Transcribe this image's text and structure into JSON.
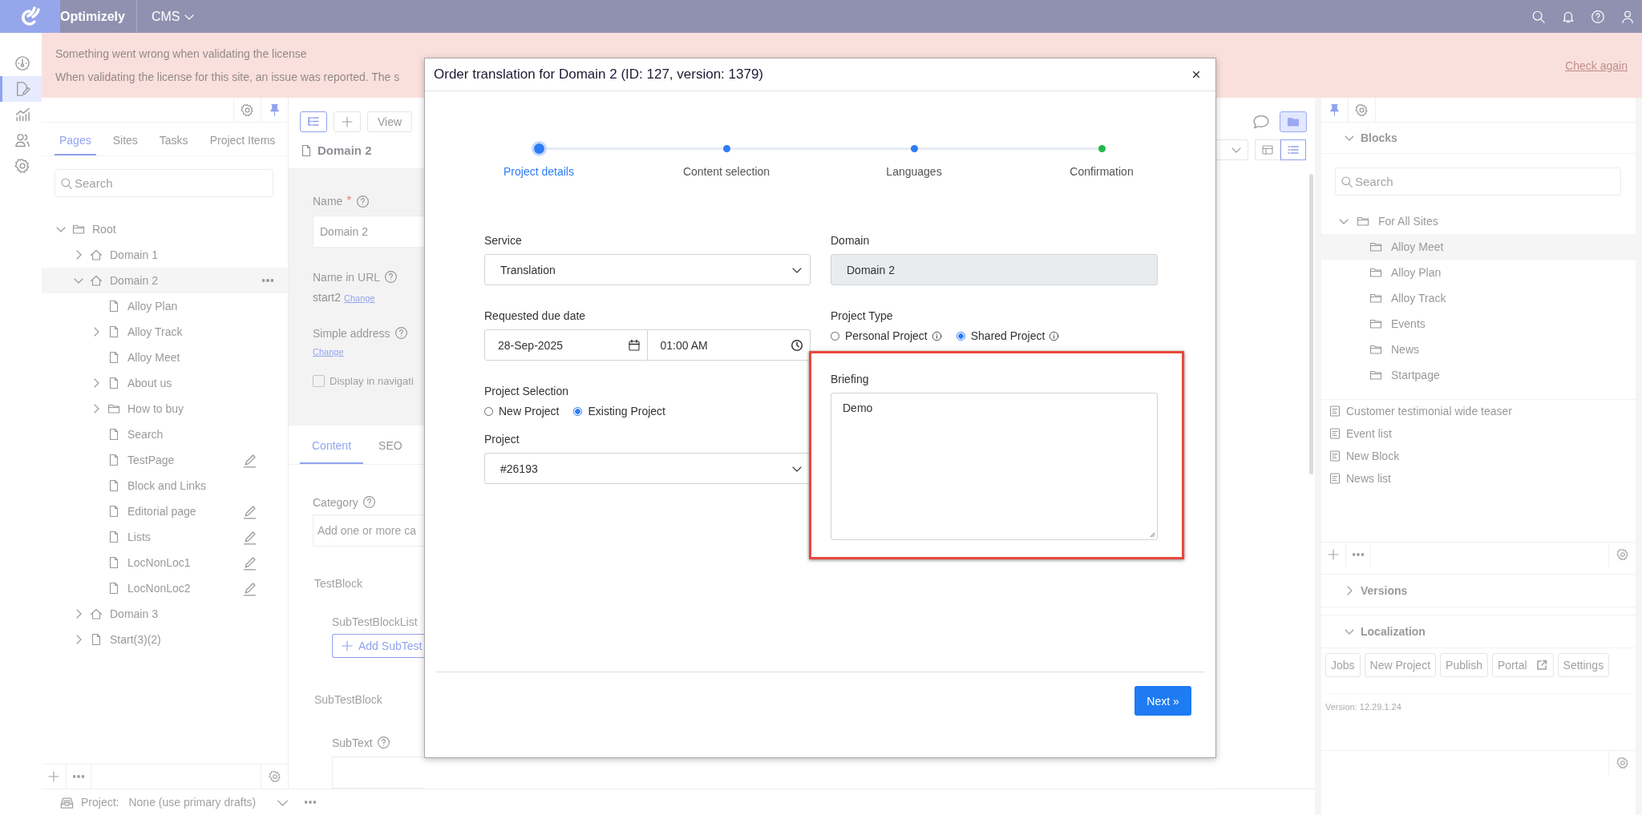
{
  "top_bar": {
    "brand": "Optimizely",
    "product": "CMS"
  },
  "nav_rail": [
    {
      "kind": "dashboard",
      "selected": false
    },
    {
      "kind": "edit",
      "selected": true
    },
    {
      "kind": "reports",
      "selected": false
    },
    {
      "kind": "users",
      "selected": false
    },
    {
      "kind": "settings",
      "selected": false
    }
  ],
  "license_banner": {
    "title": "Something went wrong when validating the license",
    "message": "When validating the license for this site, an issue was reported. The s",
    "action": "Check again"
  },
  "page_tree": {
    "tabs": [
      {
        "label": "Pages",
        "selected": true
      },
      {
        "label": "Sites",
        "selected": false
      },
      {
        "label": "Tasks",
        "selected": false
      },
      {
        "label": "Project Items",
        "selected": false
      }
    ],
    "search": {
      "placeholder": "Search"
    },
    "items": [
      {
        "label": "Root",
        "kind": "folder",
        "expanded": true,
        "selected": false,
        "edited": false,
        "children": [
          {
            "label": "Domain 1",
            "kind": "site",
            "expanded": false,
            "selected": false,
            "edited": false
          },
          {
            "label": "Domain 2",
            "kind": "site",
            "expanded": true,
            "selected": true,
            "edited": false,
            "children": [
              {
                "label": "Alloy Plan",
                "kind": "page",
                "selected": false,
                "edited": false
              },
              {
                "label": "Alloy Track",
                "kind": "page",
                "expanded": false,
                "selected": false,
                "edited": false
              },
              {
                "label": "Alloy Meet",
                "kind": "page",
                "selected": false,
                "edited": false
              },
              {
                "label": "About us",
                "kind": "page",
                "expanded": false,
                "selected": false,
                "edited": false
              },
              {
                "label": "How to buy",
                "kind": "folder",
                "expanded": false,
                "selected": false,
                "edited": false
              },
              {
                "label": "Search",
                "kind": "page",
                "selected": false,
                "edited": false
              },
              {
                "label": "TestPage",
                "kind": "page",
                "selected": false,
                "edited": true
              },
              {
                "label": "Block and Links",
                "kind": "page",
                "selected": false,
                "edited": false
              },
              {
                "label": "Editorial page",
                "kind": "page",
                "selected": false,
                "edited": true
              },
              {
                "label": "Lists",
                "kind": "page",
                "selected": false,
                "edited": true
              },
              {
                "label": "LocNonLoc1",
                "kind": "page",
                "selected": false,
                "edited": true
              },
              {
                "label": "LocNonLoc2",
                "kind": "page",
                "selected": false,
                "edited": true
              }
            ]
          },
          {
            "label": "Domain 3",
            "kind": "site",
            "expanded": false,
            "selected": false,
            "edited": false
          },
          {
            "label": "Start(3)(2)",
            "kind": "page",
            "expanded": false,
            "selected": false,
            "edited": false
          }
        ]
      }
    ]
  },
  "project_bar": {
    "label": "Project:",
    "value": "None (use primary drafts)"
  },
  "editor": {
    "view_button": "View",
    "title": "Domain 2",
    "name": {
      "label": "Name",
      "required": "*",
      "value": "Domain 2"
    },
    "name_in_url": {
      "label": "Name in URL",
      "value": "start2",
      "action": "Change"
    },
    "simple_address": {
      "label": "Simple address",
      "action": "Change"
    },
    "display_in_navigation": {
      "label": "Display in navigati",
      "checked": false
    },
    "tabs": [
      {
        "label": "Content",
        "selected": true
      },
      {
        "label": "SEO",
        "selected": false
      }
    ],
    "category": {
      "label": "Category",
      "placeholder": "Add one or more ca"
    },
    "test_block": {
      "title": "TestBlock",
      "list_label": "SubTestBlockList",
      "add_button": "Add SubTest"
    },
    "sub_test_block": {
      "title": "SubTestBlock",
      "sub_text_label": "SubText"
    }
  },
  "assets_panel": {
    "blocks": {
      "title": "Blocks",
      "expanded": true,
      "search": {
        "placeholder": "Search"
      },
      "folders": [
        {
          "label": "For All Sites",
          "expanded": true,
          "children": [
            {
              "label": "Alloy Meet",
              "selected": true
            },
            {
              "label": "Alloy Plan",
              "selected": false
            },
            {
              "label": "Alloy Track",
              "selected": false
            },
            {
              "label": "Events",
              "selected": false
            },
            {
              "label": "News",
              "selected": false
            },
            {
              "label": "Startpage",
              "selected": false
            }
          ]
        }
      ],
      "items": [
        "Customer testimonial wide teaser",
        "Event list",
        "New Block",
        "News list"
      ]
    },
    "versions": {
      "title": "Versions",
      "expanded": false
    },
    "localization": {
      "title": "Localization",
      "expanded": true,
      "buttons": [
        {
          "label": "Jobs",
          "external": false
        },
        {
          "label": "New Project",
          "external": false
        },
        {
          "label": "Publish",
          "external": false
        },
        {
          "label": "Portal",
          "external": true
        },
        {
          "label": "Settings",
          "external": false
        }
      ],
      "version": "Version: 12.29.1.24"
    }
  },
  "dialog": {
    "title": "Order translation for Domain 2 (ID: 127, version: 1379)",
    "steps": [
      {
        "label": "Project details",
        "selected": true,
        "color": "#2e7cf6"
      },
      {
        "label": "Content selection",
        "selected": false,
        "color": "#2e7cf6"
      },
      {
        "label": "Languages",
        "selected": false,
        "color": "#2e7cf6"
      },
      {
        "label": "Confirmation",
        "selected": false,
        "color": "#1fb84a"
      }
    ],
    "service": {
      "label": "Service",
      "value": "Translation"
    },
    "domain": {
      "label": "Domain",
      "value": "Domain 2"
    },
    "due_date": {
      "label": "Requested due date",
      "date": "28-Sep-2025",
      "time": "01:00 AM"
    },
    "project_type": {
      "label": "Project Type",
      "options": [
        {
          "label": "Personal Project",
          "selected": false
        },
        {
          "label": "Shared Project",
          "selected": true
        }
      ]
    },
    "project_selection": {
      "label": "Project Selection",
      "options": [
        {
          "label": "New Project",
          "selected": false
        },
        {
          "label": "Existing Project",
          "selected": true
        }
      ]
    },
    "project": {
      "label": "Project",
      "value": "#26193"
    },
    "briefing": {
      "label": "Briefing",
      "value": "Demo",
      "highlighted": true
    },
    "next_button": "Next »"
  }
}
